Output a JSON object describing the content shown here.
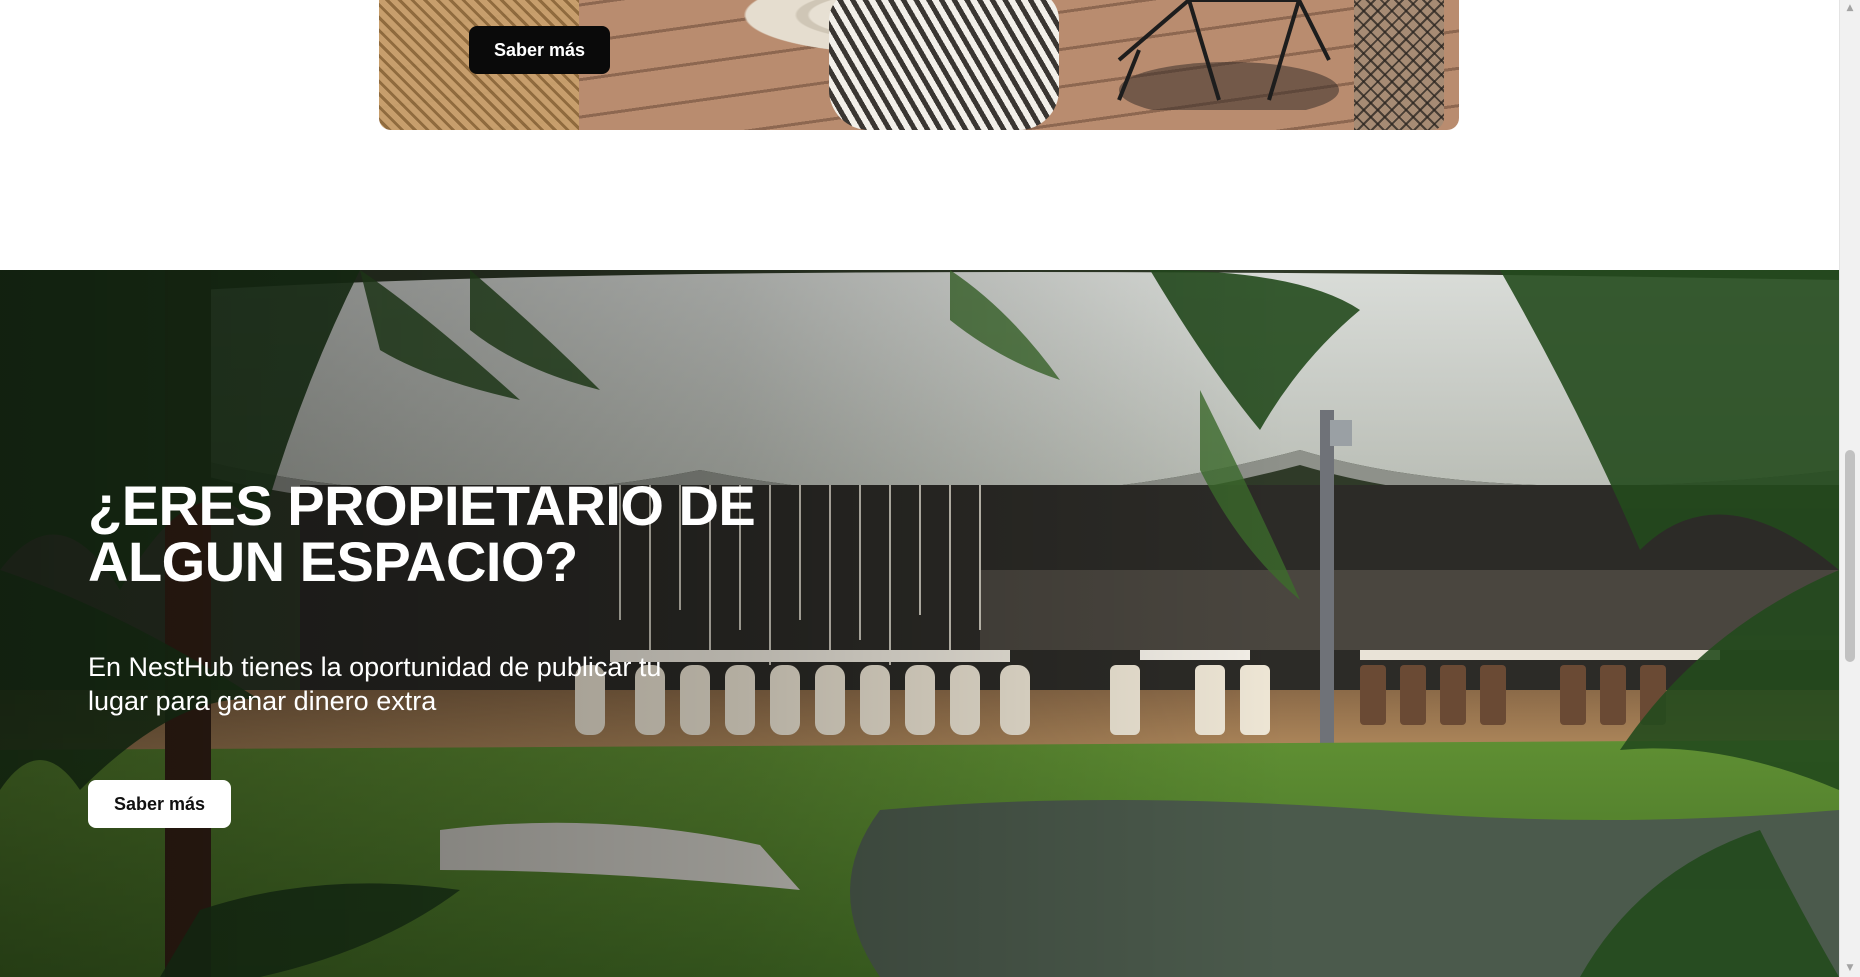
{
  "top_card": {
    "button_label": "Saber más"
  },
  "hero": {
    "title": "¿ERES PROPIETARIO DE ALGUN ESPACIO?",
    "subtitle": "En NestHub tienes la oportunidad de publicar tu lugar para ganar dinero extra",
    "button_label": "Saber más"
  },
  "scrollbar": {
    "up_arrow": "▲",
    "down_arrow": "▼"
  },
  "colors": {
    "dark_button": "#0a0a0a",
    "light_button": "#ffffff",
    "hero_text": "#ffffff",
    "page_background": "#ffffff"
  },
  "icons": {
    "scroll_up": "scroll-up-arrow-icon",
    "scroll_down": "scroll-down-arrow-icon"
  }
}
